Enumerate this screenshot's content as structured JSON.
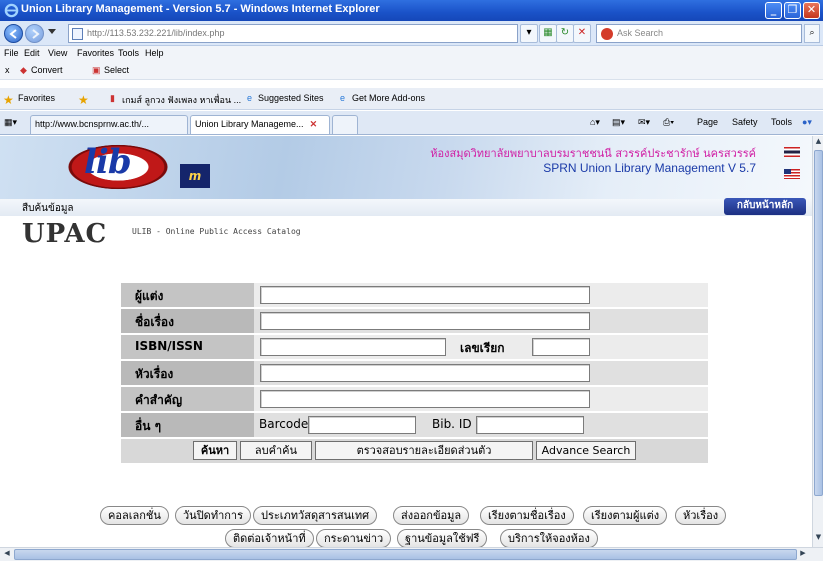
{
  "window": {
    "title": "Union Library Management - Version 5.7 - Windows Internet Explorer",
    "minimize": "_",
    "maximize": "❐",
    "close": "✕"
  },
  "address": {
    "url": "http://113.53.232.221/lib/index.php",
    "search_placeholder": "Ask Search"
  },
  "menu": [
    "File",
    "Edit",
    "View",
    "Favorites",
    "Tools",
    "Help"
  ],
  "toolbar2": {
    "close": "x",
    "convert": "Convert",
    "select": "Select"
  },
  "favorites": {
    "label": "Favorites",
    "items": [
      "เกมส์ ลูกวง ฟังเพลง หาเพื่อน ...",
      "Suggested Sites",
      "Get More Add-ons"
    ]
  },
  "tabs": [
    {
      "label": "http://www.bcnsprnw.ac.th/..."
    },
    {
      "label": "Union Library Manageme..."
    }
  ],
  "commandbar": {
    "page": "Page",
    "safety": "Safety",
    "tools": "Tools"
  },
  "banner": {
    "logo": "lib",
    "logo_badge": "m",
    "thai_name": "ห้องสมุดวิทยาลัยพยาบาลบรมราชชนนี สวรรค์ประชารักษ์ นครสวรรค์",
    "english_name": "SPRN Union Library Management V 5.7"
  },
  "nav": {
    "crumb": "สืบค้นข้อมูล",
    "home_button": "กลับหน้าหลัก"
  },
  "upac": {
    "title": "UPAC",
    "subtitle": "ULIB - Online Public Access Catalog"
  },
  "form": {
    "author": "ผู้แต่ง",
    "title": "ชื่อเรื่อง",
    "isbn": "ISBN/ISSN",
    "call_number": "เลขเรียก",
    "subject": "หัวเรื่อง",
    "keyword": "คำสำคัญ",
    "other": "อื่น ๆ",
    "barcode": "Barcode",
    "bib_id": "Bib. ID",
    "buttons": {
      "search": "ค้นหา",
      "clear": "ลบคำค้น",
      "check_personal": "ตรวจสอบรายละเอียดส่วนตัว",
      "advance": "Advance Search"
    }
  },
  "links_row1": [
    "คอลเลกชั่น",
    "วันปิดทำการ",
    "ประเภทวัสดุสารสนเทศ",
    "ส่งออกข้อมูล",
    "เรียงตามชื่อเรื่อง",
    "เรียงตามผู้แต่ง",
    "หัวเรื่อง"
  ],
  "links_row2": [
    "ติดต่อเจ้าหน้าที่",
    "กระดานข่าว",
    "ฐานข้อมูลใช้ฟรี",
    "บริการให้จองห้อง"
  ]
}
